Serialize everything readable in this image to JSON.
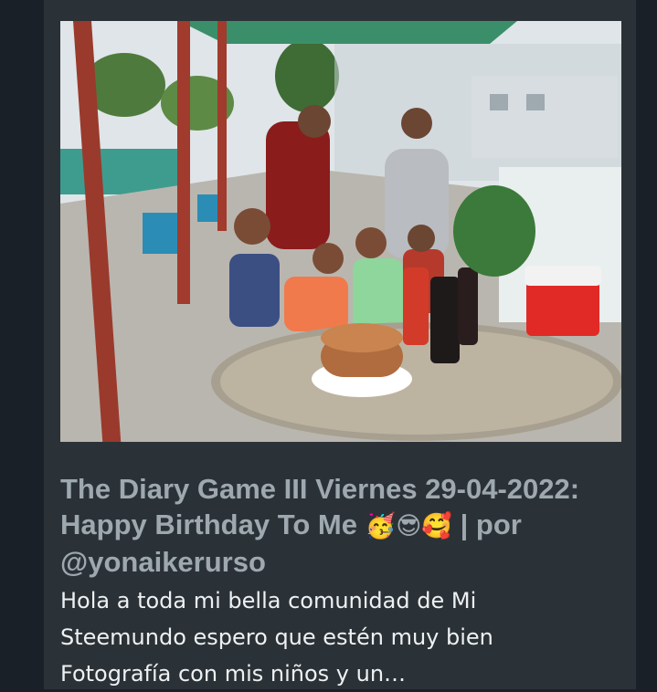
{
  "post": {
    "image_alt": "Group photo of children and adults around a birthday cake on a round wooden table",
    "title": {
      "text": "The Diary Game III Viernes 29-04-2022: Happy Birthday To Me",
      "emojis": "🥳😎🥰",
      "suffix": "| por @yonaikerurso"
    },
    "excerpt": "Hola a toda mi bella comunidad de Mi Steemundo espero que estén muy bien Fotografía con mis niños y un…"
  }
}
